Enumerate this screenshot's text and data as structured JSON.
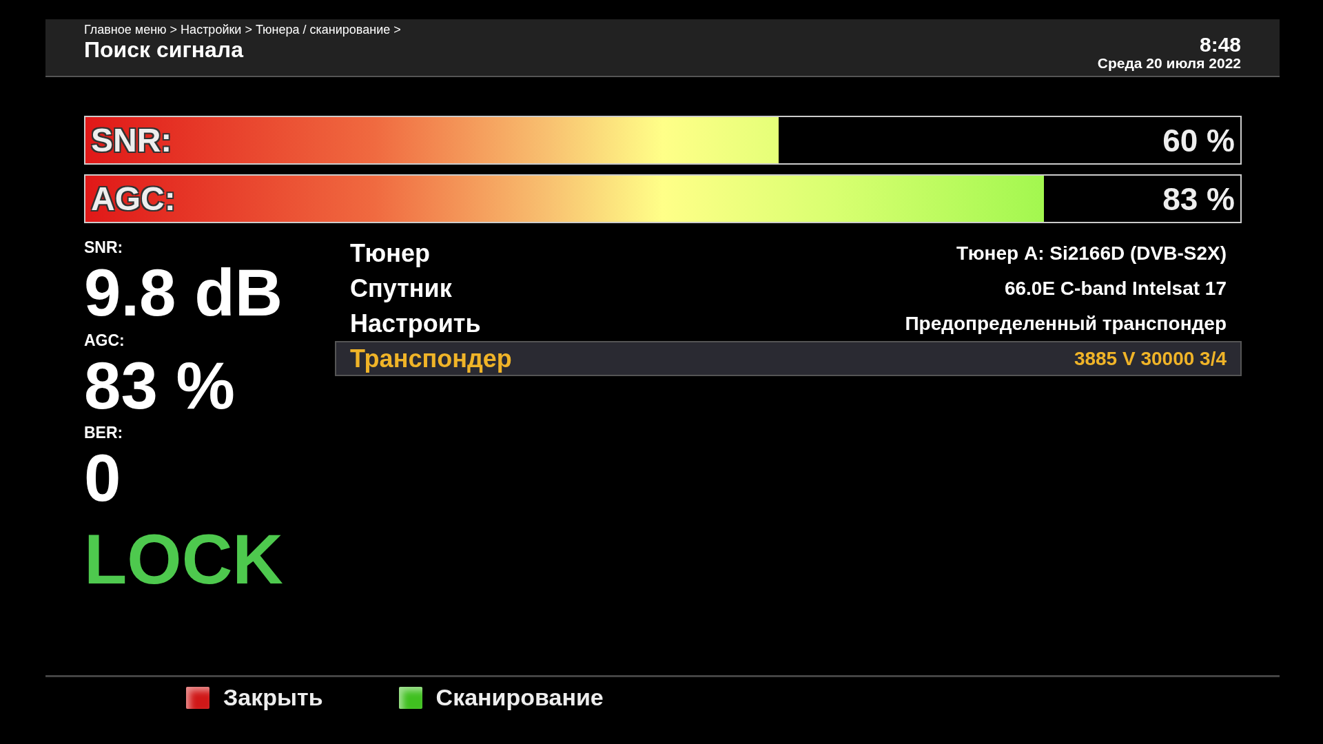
{
  "header": {
    "breadcrumb": "Главное меню > Настройки > Тюнера / сканирование >",
    "title": "Поиск сигнала",
    "time": "8:48",
    "date": "Среда 20 июля 2022"
  },
  "bars": [
    {
      "label": "SNR:",
      "level": 0.6,
      "reading": "60 %"
    },
    {
      "label": "AGC:",
      "level": 0.83,
      "reading": "83 %"
    }
  ],
  "stats": [
    {
      "label": "SNR:",
      "value": "9.8 dB"
    },
    {
      "label": "AGC:",
      "value": "83 %"
    },
    {
      "label": "BER:",
      "value": "0"
    }
  ],
  "lock_status": "LOCK",
  "settings": [
    {
      "label": "Тюнер",
      "value": "Тюнер A: Si2166D (DVB-S2X)",
      "selected": false
    },
    {
      "label": "Спутник",
      "value": "66.0E C-band Intelsat 17",
      "selected": false
    },
    {
      "label": "Настроить",
      "value": "Предопределенный транспондер",
      "selected": false
    },
    {
      "label": "Транспондер",
      "value": "3885 V 30000 3/4",
      "selected": true
    }
  ],
  "buttons": [
    {
      "label": "Закрыть",
      "color": "#d01818"
    },
    {
      "label": "Сканирование",
      "color": "#40c020"
    }
  ]
}
